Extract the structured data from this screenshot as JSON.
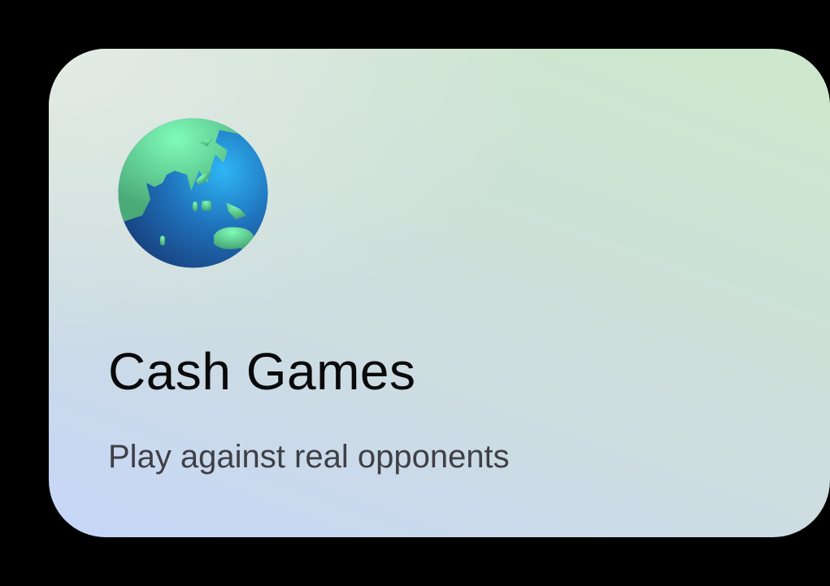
{
  "card": {
    "icon": "globe-asia-australia-icon",
    "title": "Cash Games",
    "subtitle": "Play against real opponents"
  }
}
